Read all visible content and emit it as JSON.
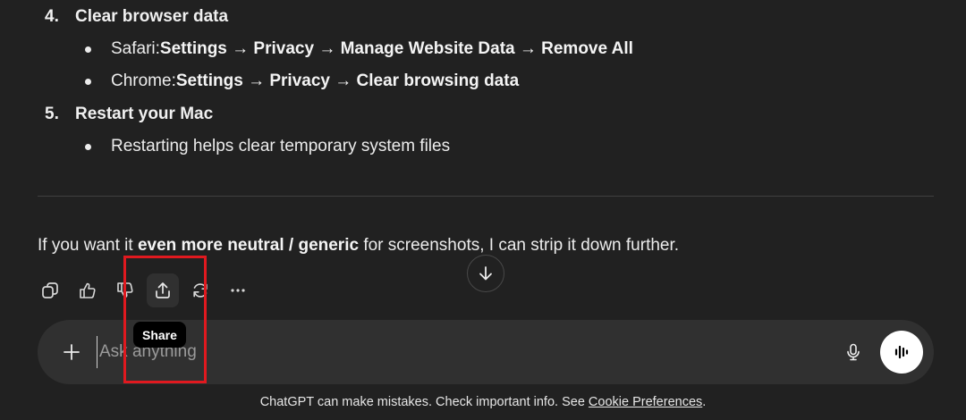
{
  "list": {
    "items": [
      {
        "num": "4.",
        "title": "Clear browser data",
        "bullets": [
          {
            "prefix": "Safari: ",
            "bold": "Settings → Privacy → Manage Website Data → Remove All"
          },
          {
            "prefix": "Chrome: ",
            "bold": "Settings → Privacy → Clear browsing data"
          }
        ]
      },
      {
        "num": "5.",
        "title": "Restart your Mac",
        "bullets": [
          {
            "prefix": "Restarting helps clear temporary system files",
            "bold": ""
          }
        ]
      }
    ]
  },
  "closing": {
    "before": "If you want it ",
    "bold": "even more neutral / generic",
    "after": " for screenshots, I can strip it down further."
  },
  "actions": {
    "items": [
      "copy-icon",
      "thumbs-up-icon",
      "thumbs-down-icon",
      "share-icon",
      "regenerate-icon",
      "more-icon"
    ],
    "tooltip": "Share"
  },
  "composer": {
    "placeholder": "Ask anything"
  },
  "footer": {
    "text": "ChatGPT can make mistakes. Check important info. See ",
    "link": "Cookie Preferences",
    "suffix": "."
  },
  "colors": {
    "background": "#212121",
    "composer": "#303030",
    "highlight": "#e0191f"
  }
}
